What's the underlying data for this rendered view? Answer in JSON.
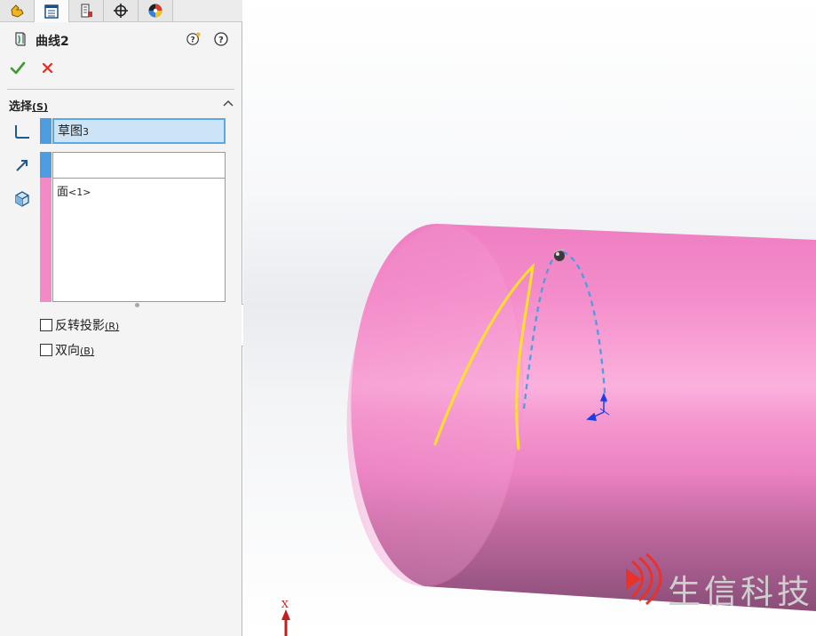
{
  "tabs": [
    {
      "name": "feature-manager",
      "icon": "feature-manager-icon"
    },
    {
      "name": "property-manager",
      "icon": "property-manager-icon"
    },
    {
      "name": "configuration-manager",
      "icon": "configuration-manager-icon"
    },
    {
      "name": "dimxpert-manager",
      "icon": "crosshair-icon"
    },
    {
      "name": "display-manager",
      "icon": "appearance-sphere-icon"
    }
  ],
  "header": {
    "title": "曲线2",
    "feature_icon": "projected-curve-icon",
    "help_icons": [
      "whats-wrong-help-icon",
      "help-icon"
    ]
  },
  "actions": {
    "ok": "checkmark-icon",
    "cancel": "close-icon"
  },
  "selection_group": {
    "title": "选择",
    "title_key": "(S)",
    "sketch_field": {
      "value": "草图",
      "suffix": "3"
    },
    "edge_field": {
      "value": ""
    },
    "face_field": {
      "value": "面",
      "suffix": "<1>"
    }
  },
  "options": [
    {
      "label": "反转投影",
      "key": "(R)",
      "checked": false
    },
    {
      "label": "双向",
      "key": "(B)",
      "checked": false
    }
  ],
  "viewport": {
    "triad_axis_label": "X"
  },
  "watermark": {
    "text": "生信科技"
  },
  "colors": {
    "accent_blue": "#4d9de0",
    "face_pink": "#f78ccd",
    "curve_yellow": "#ffe02a",
    "ok_green": "#3c9a2e",
    "cancel_red": "#d93025"
  }
}
